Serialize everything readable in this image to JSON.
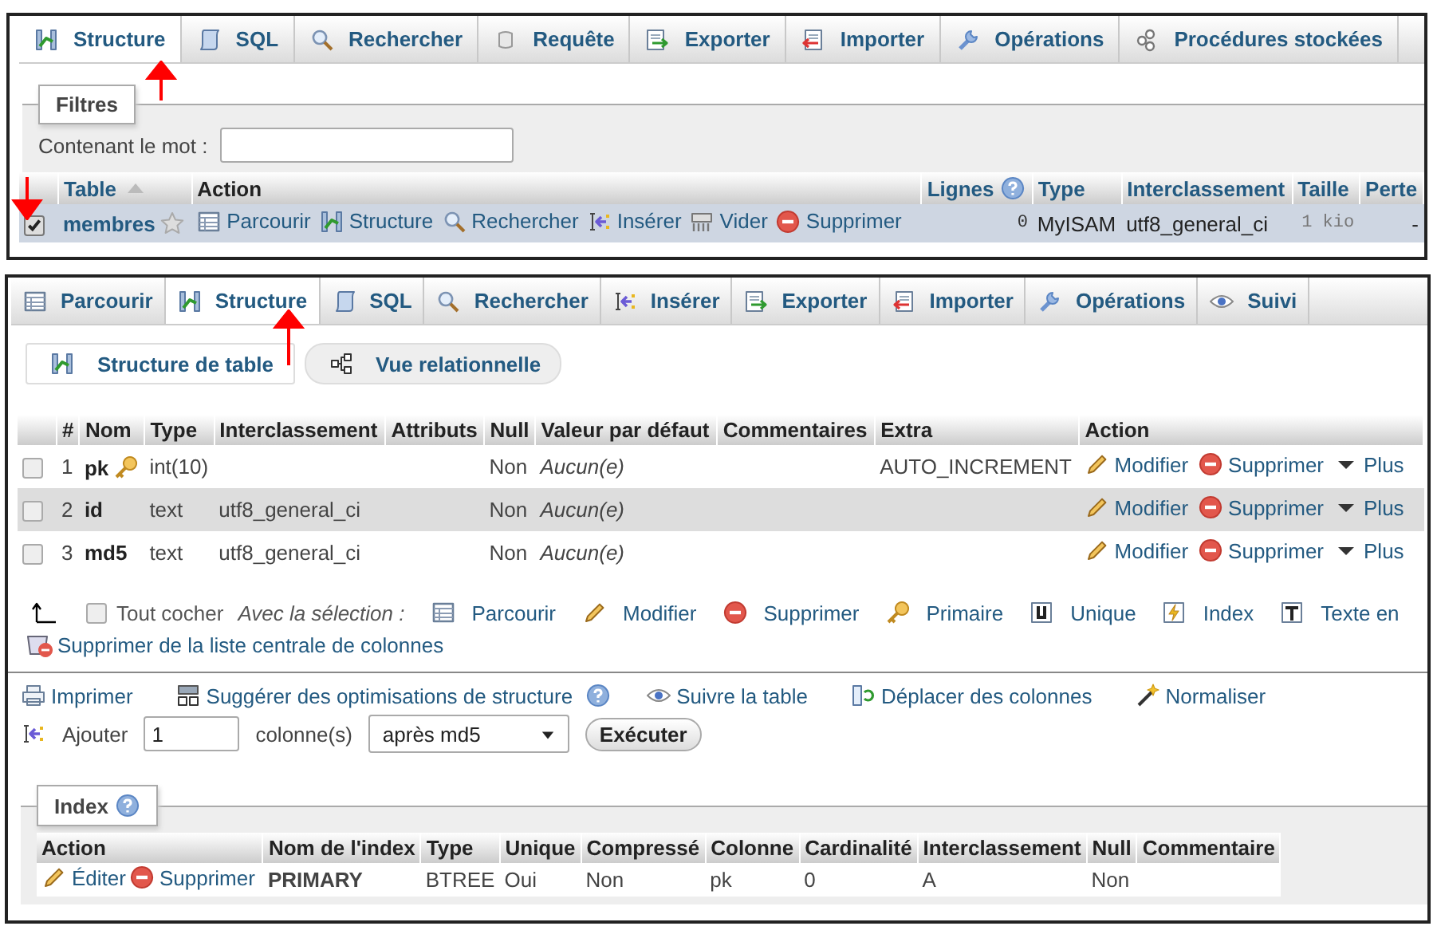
{
  "top_panel": {
    "tabs": [
      {
        "label": "Structure",
        "selected": true
      },
      {
        "label": "SQL",
        "selected": false
      },
      {
        "label": "Rechercher",
        "selected": false
      },
      {
        "label": "Requête",
        "selected": false
      },
      {
        "label": "Exporter",
        "selected": false
      },
      {
        "label": "Importer",
        "selected": false
      },
      {
        "label": "Opérations",
        "selected": false
      },
      {
        "label": "Procédures stockées",
        "selected": false
      }
    ],
    "filter": {
      "legend": "Filtres",
      "label": "Contenant le mot :"
    },
    "table": {
      "columns": [
        "Table",
        "Action",
        "Lignes",
        "Type",
        "Interclassement",
        "Taille",
        "Perte"
      ],
      "rows": [
        {
          "checked": true,
          "name": "membres",
          "favorite": false,
          "actions": [
            "Parcourir",
            "Structure",
            "Rechercher",
            "Insérer",
            "Vider",
            "Supprimer"
          ],
          "row_count": "0",
          "engine": "MyISAM",
          "collation": "utf8_general_ci",
          "size": "1 kio",
          "overhead": "-"
        }
      ]
    }
  },
  "bottom_panel": {
    "tabs": [
      {
        "label": "Parcourir",
        "selected": false
      },
      {
        "label": "Structure",
        "selected": true
      },
      {
        "label": "SQL",
        "selected": false
      },
      {
        "label": "Rechercher",
        "selected": false
      },
      {
        "label": "Insérer",
        "selected": false
      },
      {
        "label": "Exporter",
        "selected": false
      },
      {
        "label": "Importer",
        "selected": false
      },
      {
        "label": "Opérations",
        "selected": false
      },
      {
        "label": "Suivi",
        "selected": false
      }
    ],
    "subtabs": [
      {
        "label": "Structure de table",
        "selected": true
      },
      {
        "label": "Vue relationnelle",
        "selected": false
      }
    ],
    "table": {
      "columns": [
        "#",
        "Nom",
        "Type",
        "Interclassement",
        "Attributs",
        "Null",
        "Valeur par défaut",
        "Commentaires",
        "Extra",
        "Action"
      ],
      "rows": [
        {
          "checked": false,
          "number": "1",
          "name": "pk",
          "primary": true,
          "type": "int(10)",
          "null": "Non",
          "default": "Aucun(e)",
          "extra": "AUTO_INCREMENT",
          "actions": [
            "Modifier",
            "Supprimer",
            "Plus"
          ]
        },
        {
          "checked": false,
          "number": "2",
          "name": "id",
          "primary": false,
          "type": "text",
          "collation": "utf8_general_ci",
          "null": "Non",
          "default": "Aucun(e)",
          "actions": [
            "Modifier",
            "Supprimer",
            "Plus"
          ]
        },
        {
          "checked": false,
          "number": "3",
          "name": "md5",
          "primary": false,
          "type": "text",
          "collation": "utf8_general_ci",
          "null": "Non",
          "default": "Aucun(e)",
          "actions": [
            "Modifier",
            "Supprimer",
            "Plus"
          ]
        }
      ]
    },
    "bulk": {
      "check_all": {
        "label": "Tout cocher",
        "checked": false
      },
      "with_selection": "Avec la sélection :",
      "actions": [
        "Parcourir",
        "Modifier",
        "Supprimer",
        "Primaire",
        "Unique",
        "Index",
        "Texte en"
      ],
      "central_list": "Supprimer de la liste centrale de colonnes"
    },
    "links": [
      {
        "label": "Imprimer",
        "help": false
      },
      {
        "label": "Suggérer des optimisations de structure",
        "help": true
      },
      {
        "label": "Suivre la table",
        "help": false
      },
      {
        "label": "Déplacer des colonnes",
        "help": false
      },
      {
        "label": "Normaliser",
        "help": false
      }
    ],
    "add_columns": {
      "label": "Ajouter",
      "value": "1",
      "unit": "colonne(s)",
      "position": "après md5",
      "button": "Exécuter"
    },
    "index": {
      "legend": "Index",
      "columns": [
        "Action",
        "Nom de l'index",
        "Type",
        "Unique",
        "Compressé",
        "Colonne",
        "Cardinalité",
        "Interclassement",
        "Null",
        "Commentaire"
      ],
      "rows": [
        {
          "actions": [
            "Éditer",
            "Supprimer"
          ],
          "name": "PRIMARY",
          "type": "BTREE",
          "unique": "Oui",
          "compressed": "Non",
          "column": "pk",
          "cardinality": "0",
          "collation": "A",
          "null": "Non"
        }
      ]
    }
  }
}
